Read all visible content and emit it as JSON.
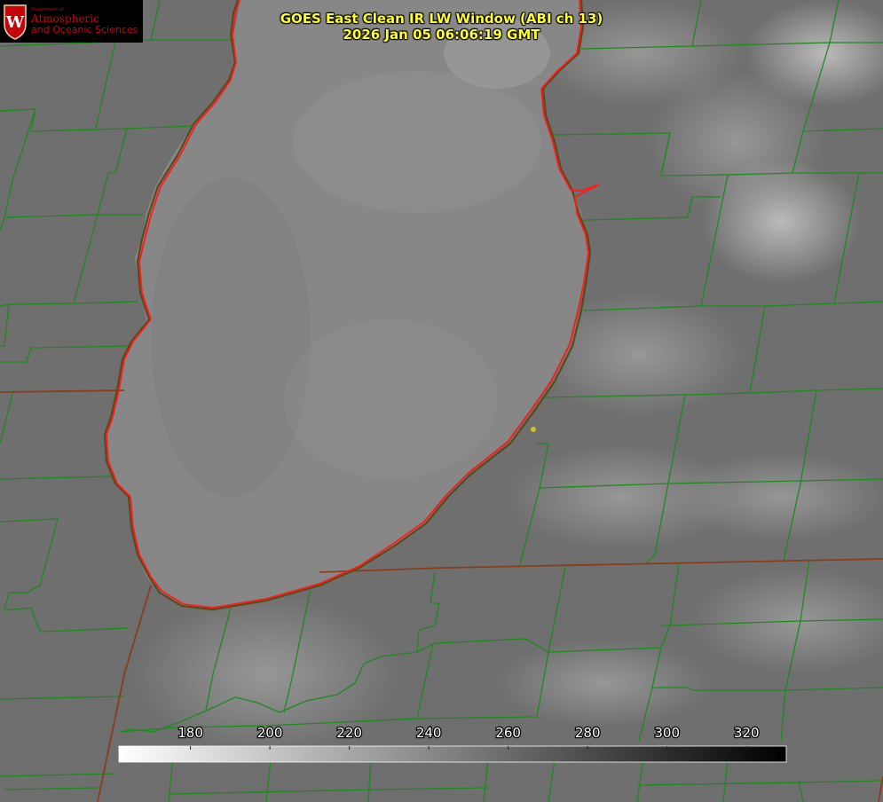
{
  "title": {
    "line1": "GOES East Clean IR LW Window (ABI ch 13)",
    "line2": "2026 Jan 05 06:06:19 GMT"
  },
  "logo": {
    "seal_letter": "W",
    "dept_text": "Department of",
    "line1": "Atmospheric",
    "line2": "and Oceanic Sciences"
  },
  "colorbar": {
    "ticks": [
      180,
      200,
      220,
      240,
      260,
      280,
      300,
      320
    ],
    "min": 162,
    "max": 330,
    "gradient": [
      "#ffffff",
      "#000000"
    ]
  },
  "colors": {
    "title": "#ffff33",
    "county_lines": "#1f8a1f",
    "state_lines": "#8a3a1a",
    "shoreline": "#ff1a1a",
    "lake": "#8b8b8b",
    "land": "#6e6e6e",
    "point_marker": "#d4c21c",
    "logo_text": "#c5050c"
  }
}
